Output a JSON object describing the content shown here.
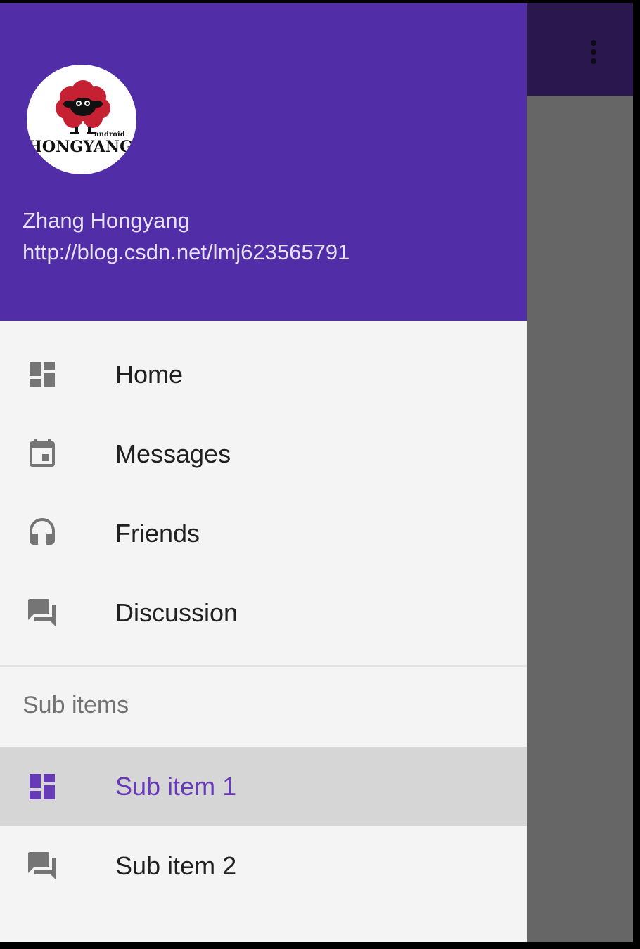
{
  "drawer": {
    "header": {
      "avatar_text": "HONGYANG",
      "avatar_small_text": "android",
      "name": "Zhang Hongyang",
      "url": "http://blog.csdn.net/lmj623565791"
    },
    "items": [
      {
        "label": "Home",
        "icon": "dashboard-icon"
      },
      {
        "label": "Messages",
        "icon": "calendar-event-icon"
      },
      {
        "label": "Friends",
        "icon": "headset-icon"
      },
      {
        "label": "Discussion",
        "icon": "forum-icon"
      }
    ],
    "subheader": "Sub items",
    "sub_items": [
      {
        "label": "Sub item 1",
        "icon": "dashboard-icon",
        "selected": true
      },
      {
        "label": "Sub item 2",
        "icon": "forum-icon",
        "selected": false
      }
    ]
  },
  "app": {
    "overflow_icon": "more-vert-icon"
  },
  "colors": {
    "header_bg": "#512da8",
    "toolbar_scrimmed": "#29174d",
    "content_scrimmed": "#666666",
    "drawer_bg": "#f4f4f4",
    "selected_bg": "#d6d6d6",
    "accent": "#673ab7",
    "icon_gray": "#757575"
  }
}
